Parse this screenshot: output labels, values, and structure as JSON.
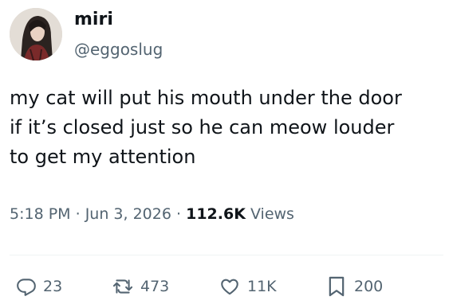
{
  "author": {
    "display_name": "miri",
    "handle": "@eggoslug"
  },
  "tweet": {
    "text_lines": [
      "my cat will put his mouth under the door",
      "if it’s closed just so he can meow louder",
      "to get my attention"
    ]
  },
  "meta": {
    "time": "5:18 PM",
    "separator": "·",
    "date": "Jun 3, 2026",
    "views_count": "112.6K",
    "views_label": "Views"
  },
  "actions": {
    "replies": "23",
    "reposts": "473",
    "likes": "11K",
    "bookmarks": "200"
  },
  "colors": {
    "text": "#0f1419",
    "secondary": "#536471",
    "divider": "#eff3f4"
  },
  "icons": {
    "reply": "reply-icon",
    "repost": "repost-icon",
    "like": "heart-icon",
    "bookmark": "bookmark-icon"
  }
}
